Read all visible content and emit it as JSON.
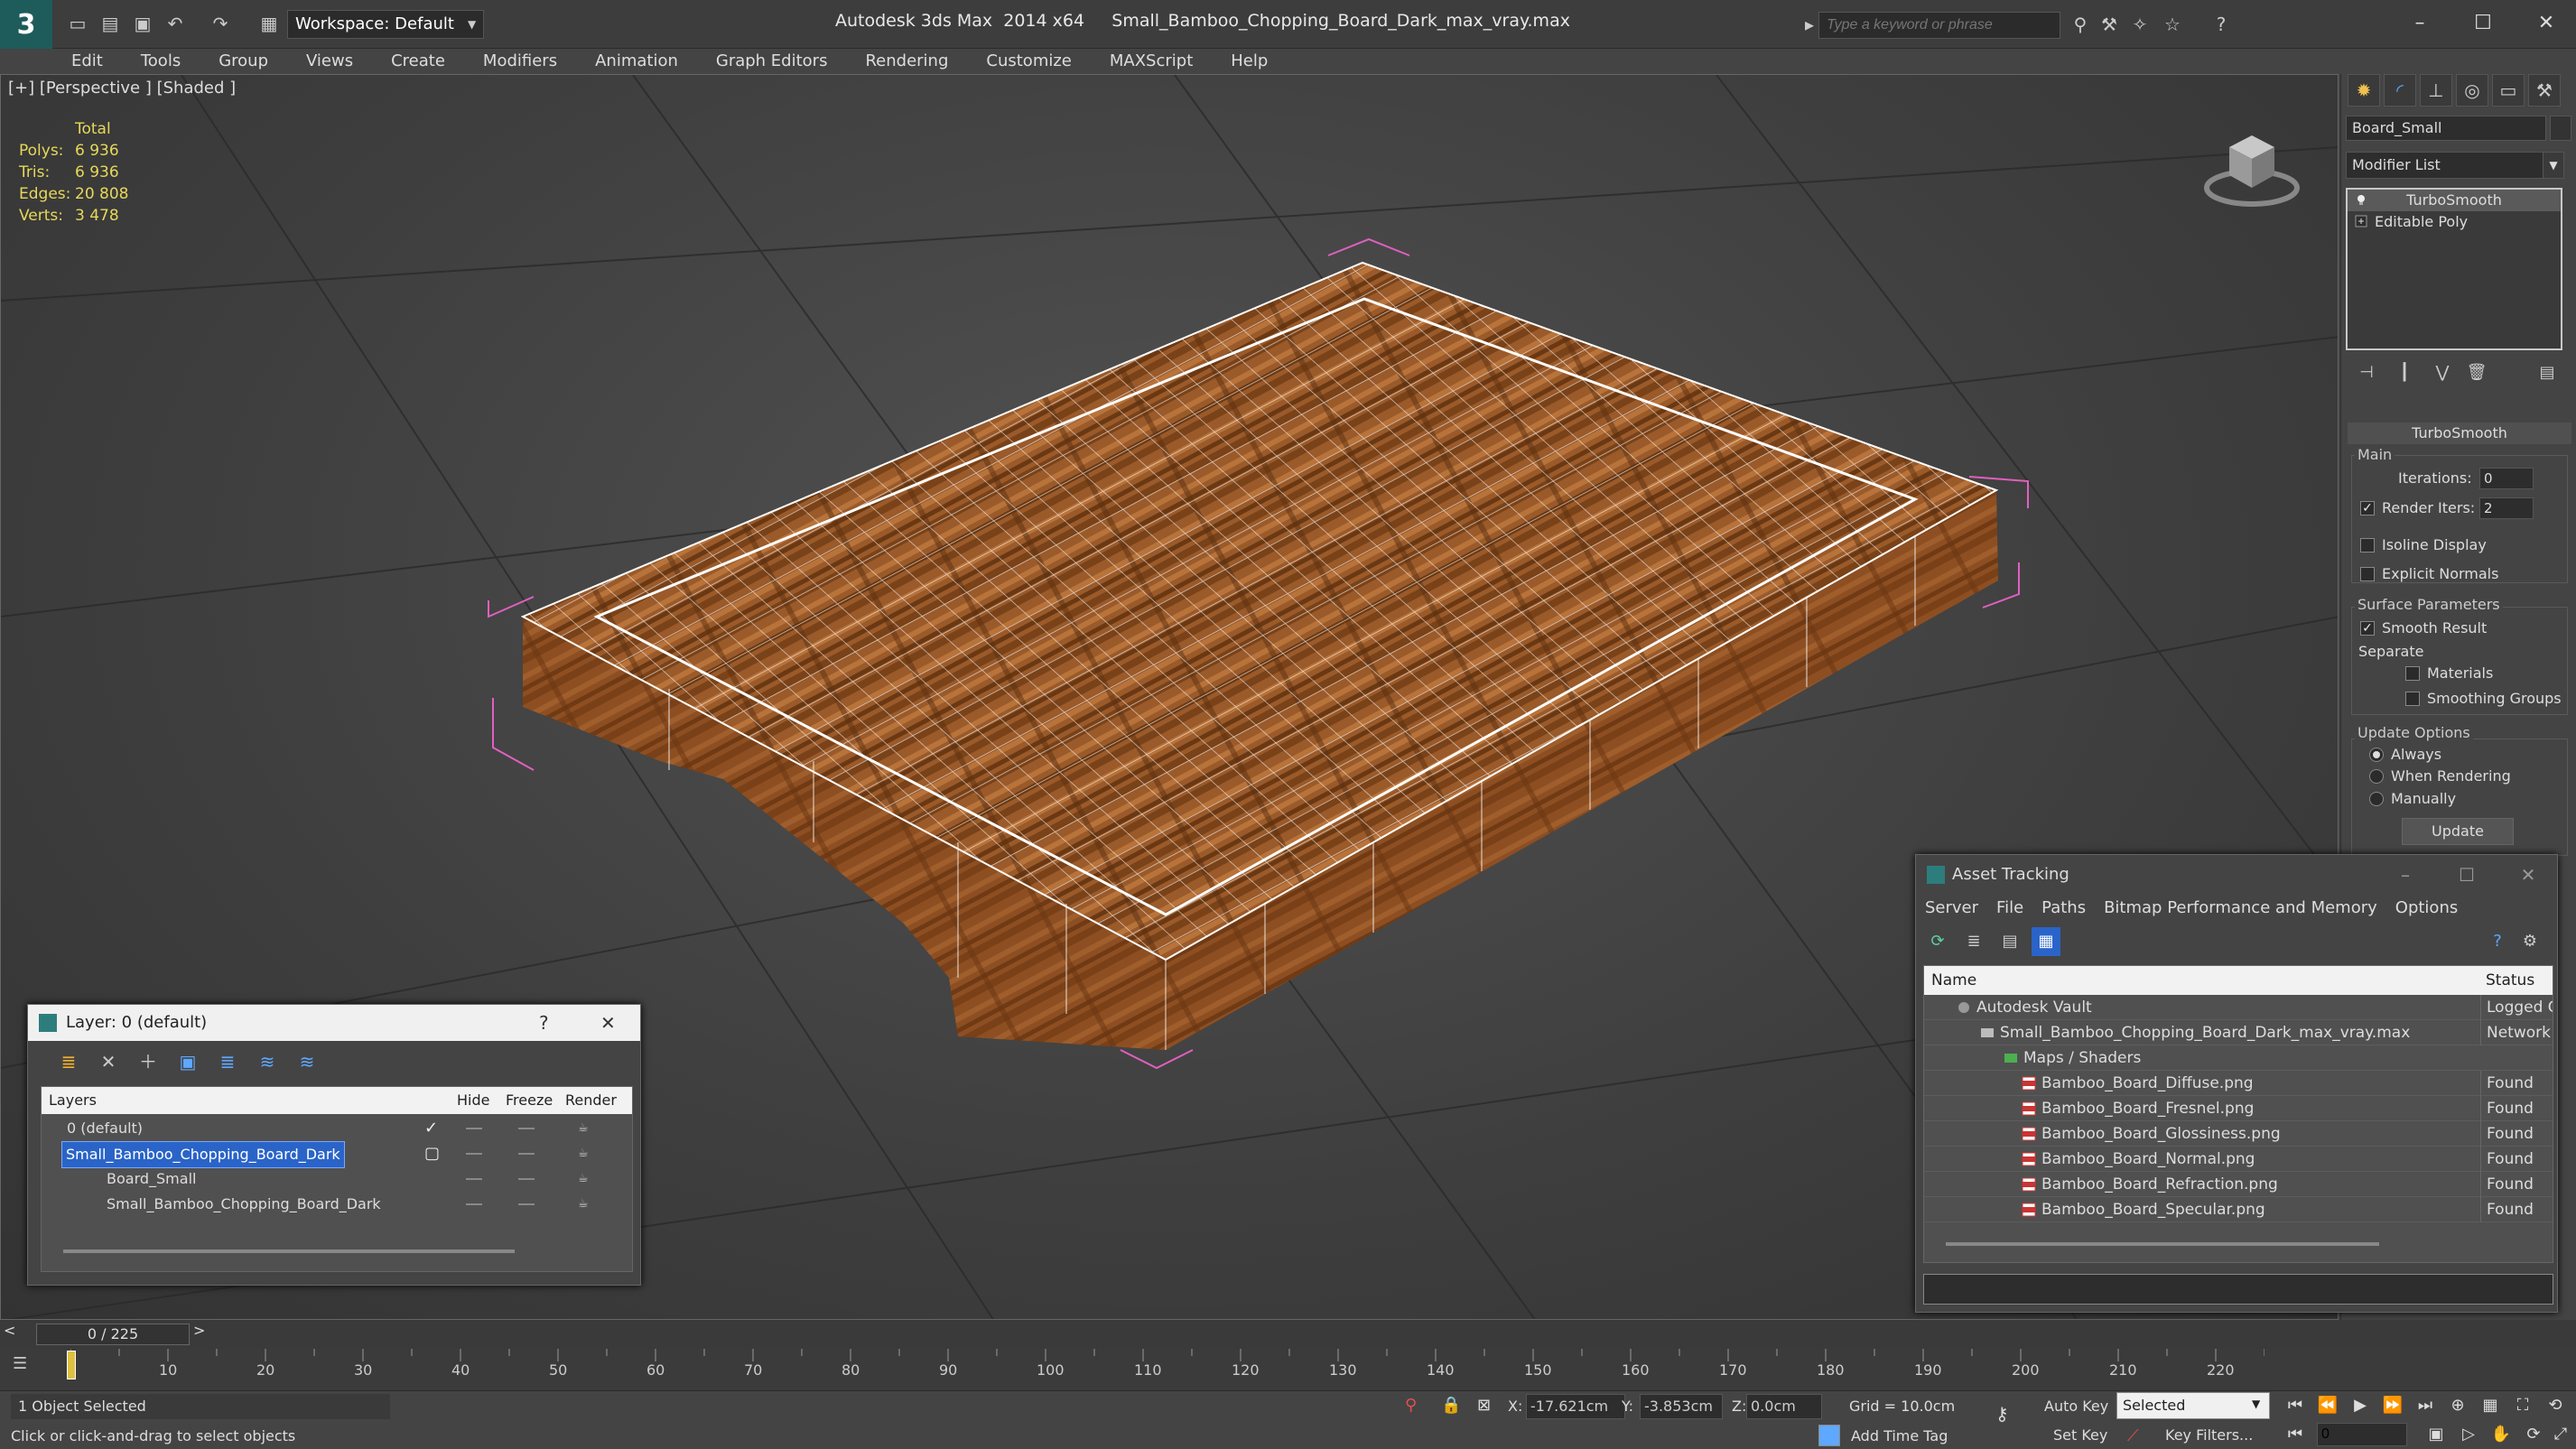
{
  "app": {
    "title": "Autodesk 3ds Max  2014 x64     Small_Bamboo_Chopping_Board_Dark_max_vray.max",
    "workspace": "Workspace: Default",
    "search_placeholder": "Type a keyword or phrase"
  },
  "menu": [
    "Edit",
    "Tools",
    "Group",
    "Views",
    "Create",
    "Modifiers",
    "Animation",
    "Graph Editors",
    "Rendering",
    "Customize",
    "MAXScript",
    "Help"
  ],
  "viewport": {
    "label": "[+] [Perspective ] [Shaded ]",
    "stats": {
      "header": "Total",
      "rows": [
        {
          "k": "Polys:",
          "v": "6 936"
        },
        {
          "k": "Tris:",
          "v": "6 936"
        },
        {
          "k": "Edges:",
          "v": "20 808"
        },
        {
          "k": "Verts:",
          "v": "3 478"
        }
      ]
    }
  },
  "command_panel": {
    "object_name": "Board_Small",
    "modifier_list": "Modifier List",
    "stack": [
      "TurboSmooth",
      "Editable Poly"
    ],
    "rollout": "TurboSmooth",
    "main_label": "Main",
    "iterations_label": "Iterations:",
    "iterations": "0",
    "render_iters_label": "Render Iters:",
    "render_iters": "2",
    "isoline": "Isoline Display",
    "explicit": "Explicit Normals",
    "surface_label": "Surface Parameters",
    "smooth_result": "Smooth Result",
    "separate": "Separate",
    "materials": "Materials",
    "smoothing_groups": "Smoothing Groups",
    "update_options": "Update Options",
    "always": "Always",
    "when_rendering": "When Rendering",
    "manually": "Manually",
    "update_btn": "Update"
  },
  "layer_dialog": {
    "title": "Layer: 0 (default)",
    "help": "?",
    "close": "✕",
    "headers": {
      "layers": "Layers",
      "hide": "Hide",
      "freeze": "Freeze",
      "render": "Render"
    },
    "rows": [
      {
        "name": "0 (default)",
        "indent": 0
      },
      {
        "name": "Small_Bamboo_Chopping_Board_Dark",
        "indent": 0
      },
      {
        "name": "Board_Small",
        "indent": 1
      },
      {
        "name": "Small_Bamboo_Chopping_Board_Dark",
        "indent": 1
      }
    ]
  },
  "asset_dialog": {
    "title": "Asset Tracking",
    "menu": [
      "Server",
      "File",
      "Paths",
      "Bitmap Performance and Memory",
      "Options"
    ],
    "headers": {
      "name": "Name",
      "status": "Status"
    },
    "rows": [
      {
        "name": "Autodesk Vault",
        "status": "Logged Out"
      },
      {
        "name": "Small_Bamboo_Chopping_Board_Dark_max_vray.max",
        "status": "Network Path"
      },
      {
        "name": "Maps / Shaders",
        "status": ""
      },
      {
        "name": "Bamboo_Board_Diffuse.png",
        "status": "Found"
      },
      {
        "name": "Bamboo_Board_Fresnel.png",
        "status": "Found"
      },
      {
        "name": "Bamboo_Board_Glossiness.png",
        "status": "Found"
      },
      {
        "name": "Bamboo_Board_Normal.png",
        "status": "Found"
      },
      {
        "name": "Bamboo_Board_Refraction.png",
        "status": "Found"
      },
      {
        "name": "Bamboo_Board_Specular.png",
        "status": "Found"
      }
    ]
  },
  "timeline": {
    "frame_box": "0 / 225",
    "ticks": [
      "10",
      "20",
      "30",
      "40",
      "50",
      "60",
      "70",
      "80",
      "90",
      "100",
      "110",
      "120",
      "130",
      "140",
      "150",
      "160",
      "170",
      "180",
      "190",
      "200",
      "210",
      "220"
    ]
  },
  "status": {
    "selected": "1 Object Selected",
    "prompt": "Click or click-and-drag to select objects",
    "x_label": "X:",
    "x": "-17.621cm",
    "y_label": "Y:",
    "y": "-3.853cm",
    "z_label": "Z:",
    "z": "0.0cm",
    "grid": "Grid = 10.0cm",
    "add_time_tag": "Add Time Tag",
    "auto_key": "Auto Key",
    "set_key": "Set Key",
    "selected_dd": "Selected",
    "key_filters": "Key Filters...",
    "frame": "0"
  },
  "colors": {
    "stats": "#e6d85a",
    "selection": "#2a64c8",
    "wire": "#ffffff",
    "gizmo": "#e060c0"
  }
}
